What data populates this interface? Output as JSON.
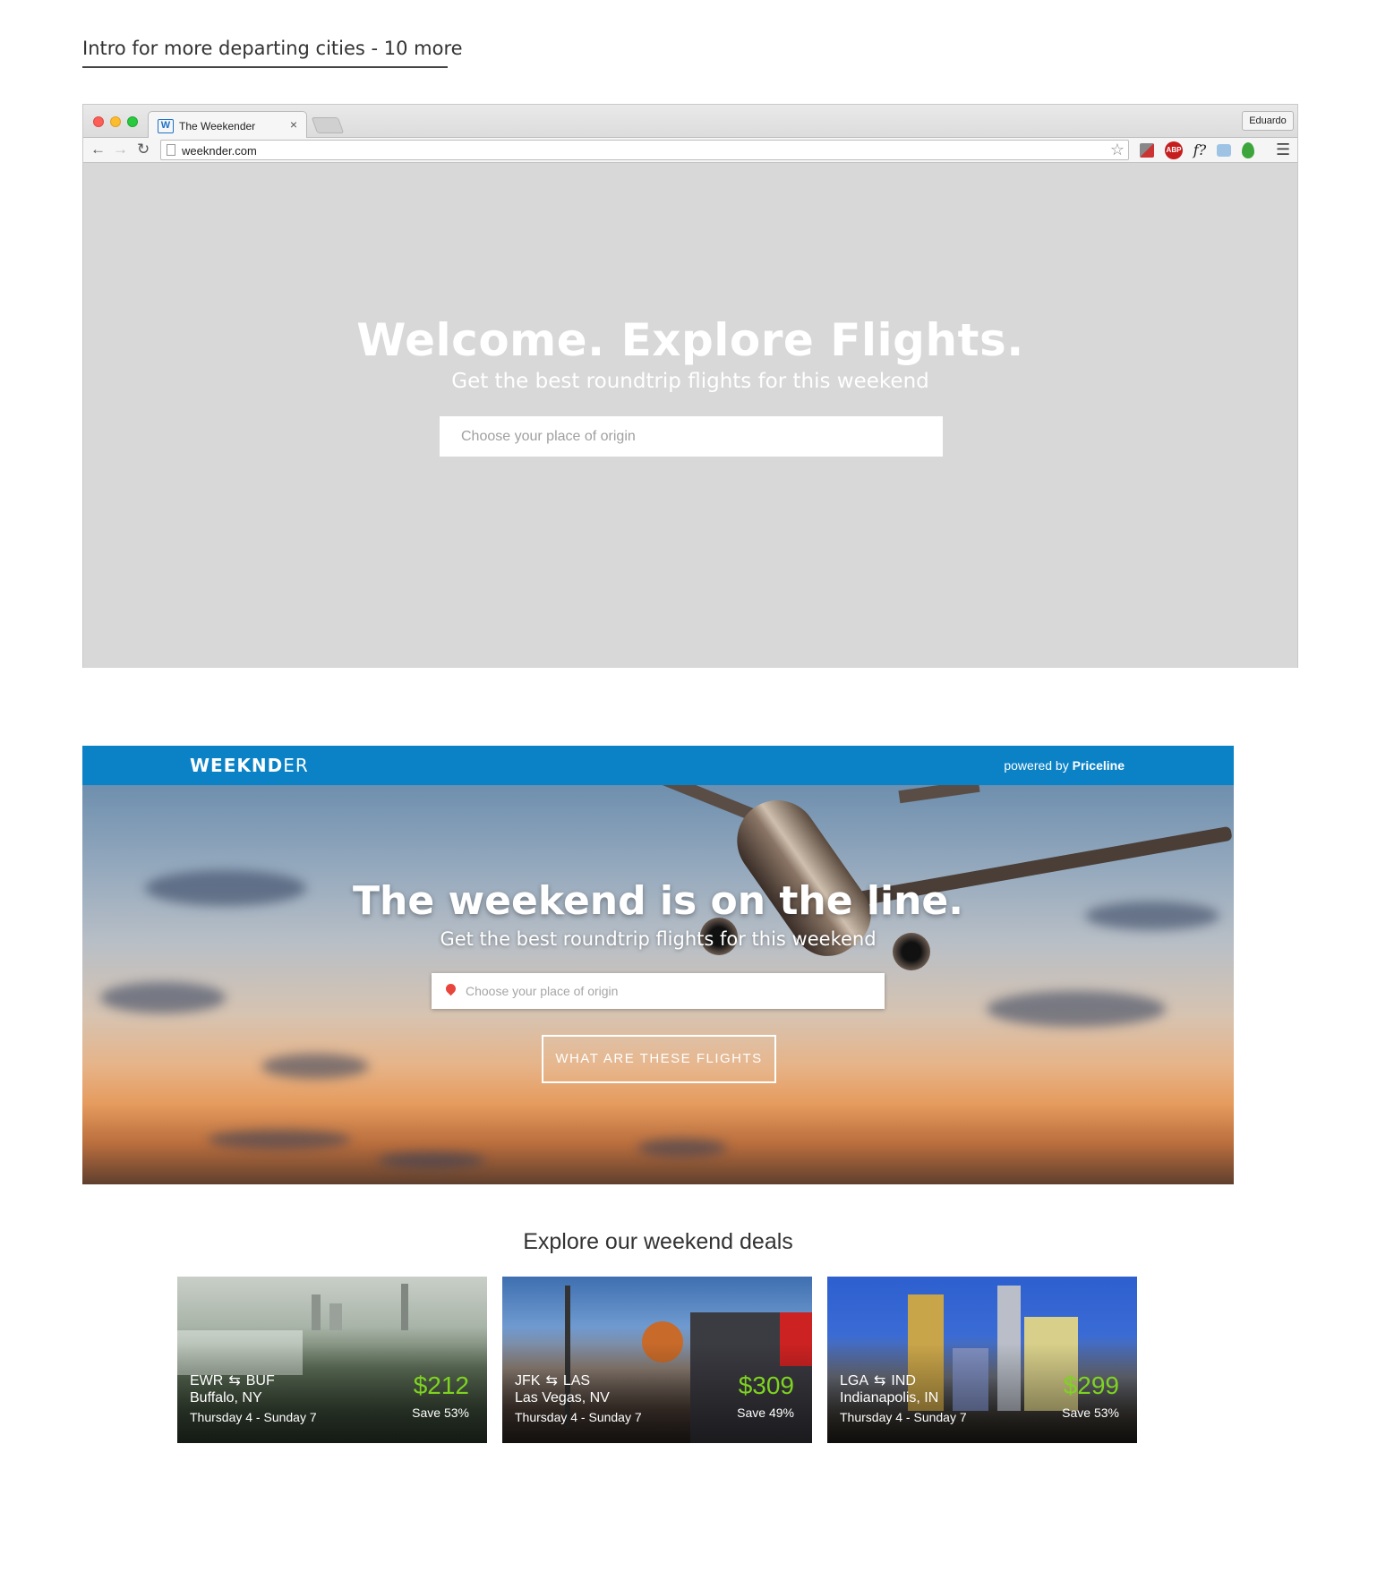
{
  "section": {
    "heading": "Intro for more departing cities - 10 more"
  },
  "browser": {
    "tab_title": "The Weekender",
    "tab_favicon": "W",
    "tab_close": "×",
    "profile": "Eduardo",
    "url": "weeknder.com",
    "ext_abp": "ABP",
    "ext_font": "f?",
    "icons": [
      "back-arrow-icon",
      "forward-arrow-icon",
      "reload-icon",
      "page-icon",
      "star-icon",
      "tools-icon",
      "adblock-icon",
      "font-icon",
      "camera-icon",
      "evernote-icon",
      "menu-icon"
    ]
  },
  "intro": {
    "title": "Welcome. Explore Flights.",
    "subtitle": "Get the best roundtrip flights for this weekend",
    "placeholder": "Choose your place of origin"
  },
  "site": {
    "logo_bold": "WEEKND",
    "logo_light": "ER",
    "powered_prefix": "powered by",
    "powered_brand": "Priceline",
    "brand_color": "#0b82c6",
    "hero": {
      "title": "The weekend is on the line.",
      "subtitle": "Get the best roundtrip flights for this weekend",
      "placeholder": "Choose your place of origin",
      "button": "WHAT ARE THESE FLIGHTS"
    },
    "deals_heading": "Explore our weekend deals",
    "price_color": "#7ed321",
    "deals": [
      {
        "from": "EWR",
        "to": "BUF",
        "city": "Buffalo, NY",
        "dates": "Thursday 4 - Sunday 7",
        "price": "$212",
        "save": "Save 53%"
      },
      {
        "from": "JFK",
        "to": "LAS",
        "city": "Las Vegas, NV",
        "dates": "Thursday 4 - Sunday 7",
        "price": "$309",
        "save": "Save 49%"
      },
      {
        "from": "LGA",
        "to": "IND",
        "city": "Indianapolis, IN",
        "dates": "Thursday 4 - Sunday 7",
        "price": "$299",
        "save": "Save 53%"
      }
    ]
  }
}
